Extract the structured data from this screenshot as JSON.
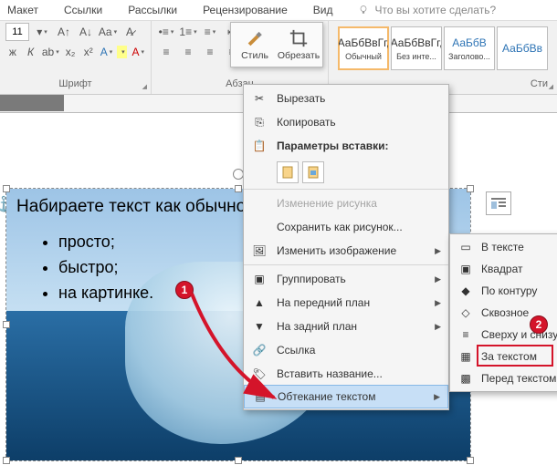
{
  "tabs": {
    "layout": "Макет",
    "links": "Ссылки",
    "mailings": "Рассылки",
    "review": "Рецензирование",
    "view": "Вид",
    "tellme": "Что вы хотите сделать?"
  },
  "font": {
    "size": "11"
  },
  "groups": {
    "font": "Шрифт",
    "para": "Абзац",
    "styles": "Сти"
  },
  "style_boxes": [
    {
      "sample": "АаБбВвГг,",
      "name": "Обычный",
      "blue": false
    },
    {
      "sample": "АаБбВвГг,",
      "name": "Без инте...",
      "blue": false
    },
    {
      "sample": "АаБбВ",
      "name": "Заголово...",
      "blue": true
    },
    {
      "sample": "АаБбВв",
      "name": "",
      "blue": true
    }
  ],
  "mini": {
    "style": "Стиль",
    "crop": "Обрезать"
  },
  "document": {
    "title": "Набираете текст как обычно.",
    "bullets": [
      "просто;",
      "быстро;",
      "на картинке."
    ]
  },
  "context": {
    "cut": "Вырезать",
    "copy": "Копировать",
    "paste_hdr": "Параметры вставки:",
    "change_pic": "Изменение рисунка",
    "save_pic": "Сохранить как рисунок...",
    "edit_pic": "Изменить изображение",
    "group": "Группировать",
    "front": "На передний план",
    "back": "На задний план",
    "link": "Ссылка",
    "caption": "Вставить название...",
    "wrap": "Обтекание текстом"
  },
  "wrap_sub": {
    "inline": "В тексте",
    "square": "Квадрат",
    "tight": "По контуру",
    "through": "Сквозное",
    "topbottom": "Сверху и снизу",
    "behind": "За текстом",
    "front": "Перед текстом"
  },
  "badges": {
    "one": "1",
    "two": "2"
  }
}
